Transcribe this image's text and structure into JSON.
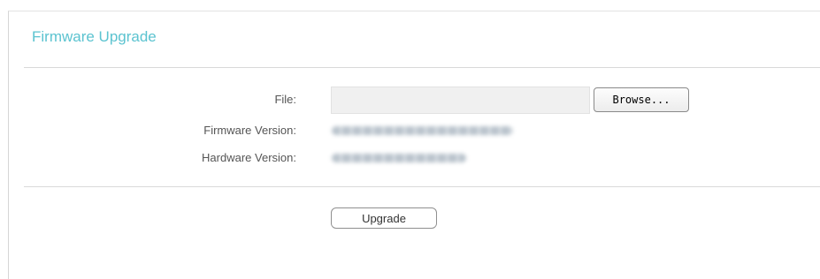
{
  "section": {
    "title": "Firmware Upgrade"
  },
  "form": {
    "file_label": "File:",
    "file_value": "",
    "browse_label": "Browse...",
    "firmware_version_label": "Firmware Version:",
    "firmware_version_value": "(blurred)",
    "hardware_version_label": "Hardware Version:",
    "hardware_version_value": "(blurred)"
  },
  "actions": {
    "upgrade_label": "Upgrade"
  },
  "colors": {
    "title": "#5bc3d0",
    "label": "#555555",
    "divider": "#d9d9d9",
    "input_bg": "#f0f0f0"
  }
}
